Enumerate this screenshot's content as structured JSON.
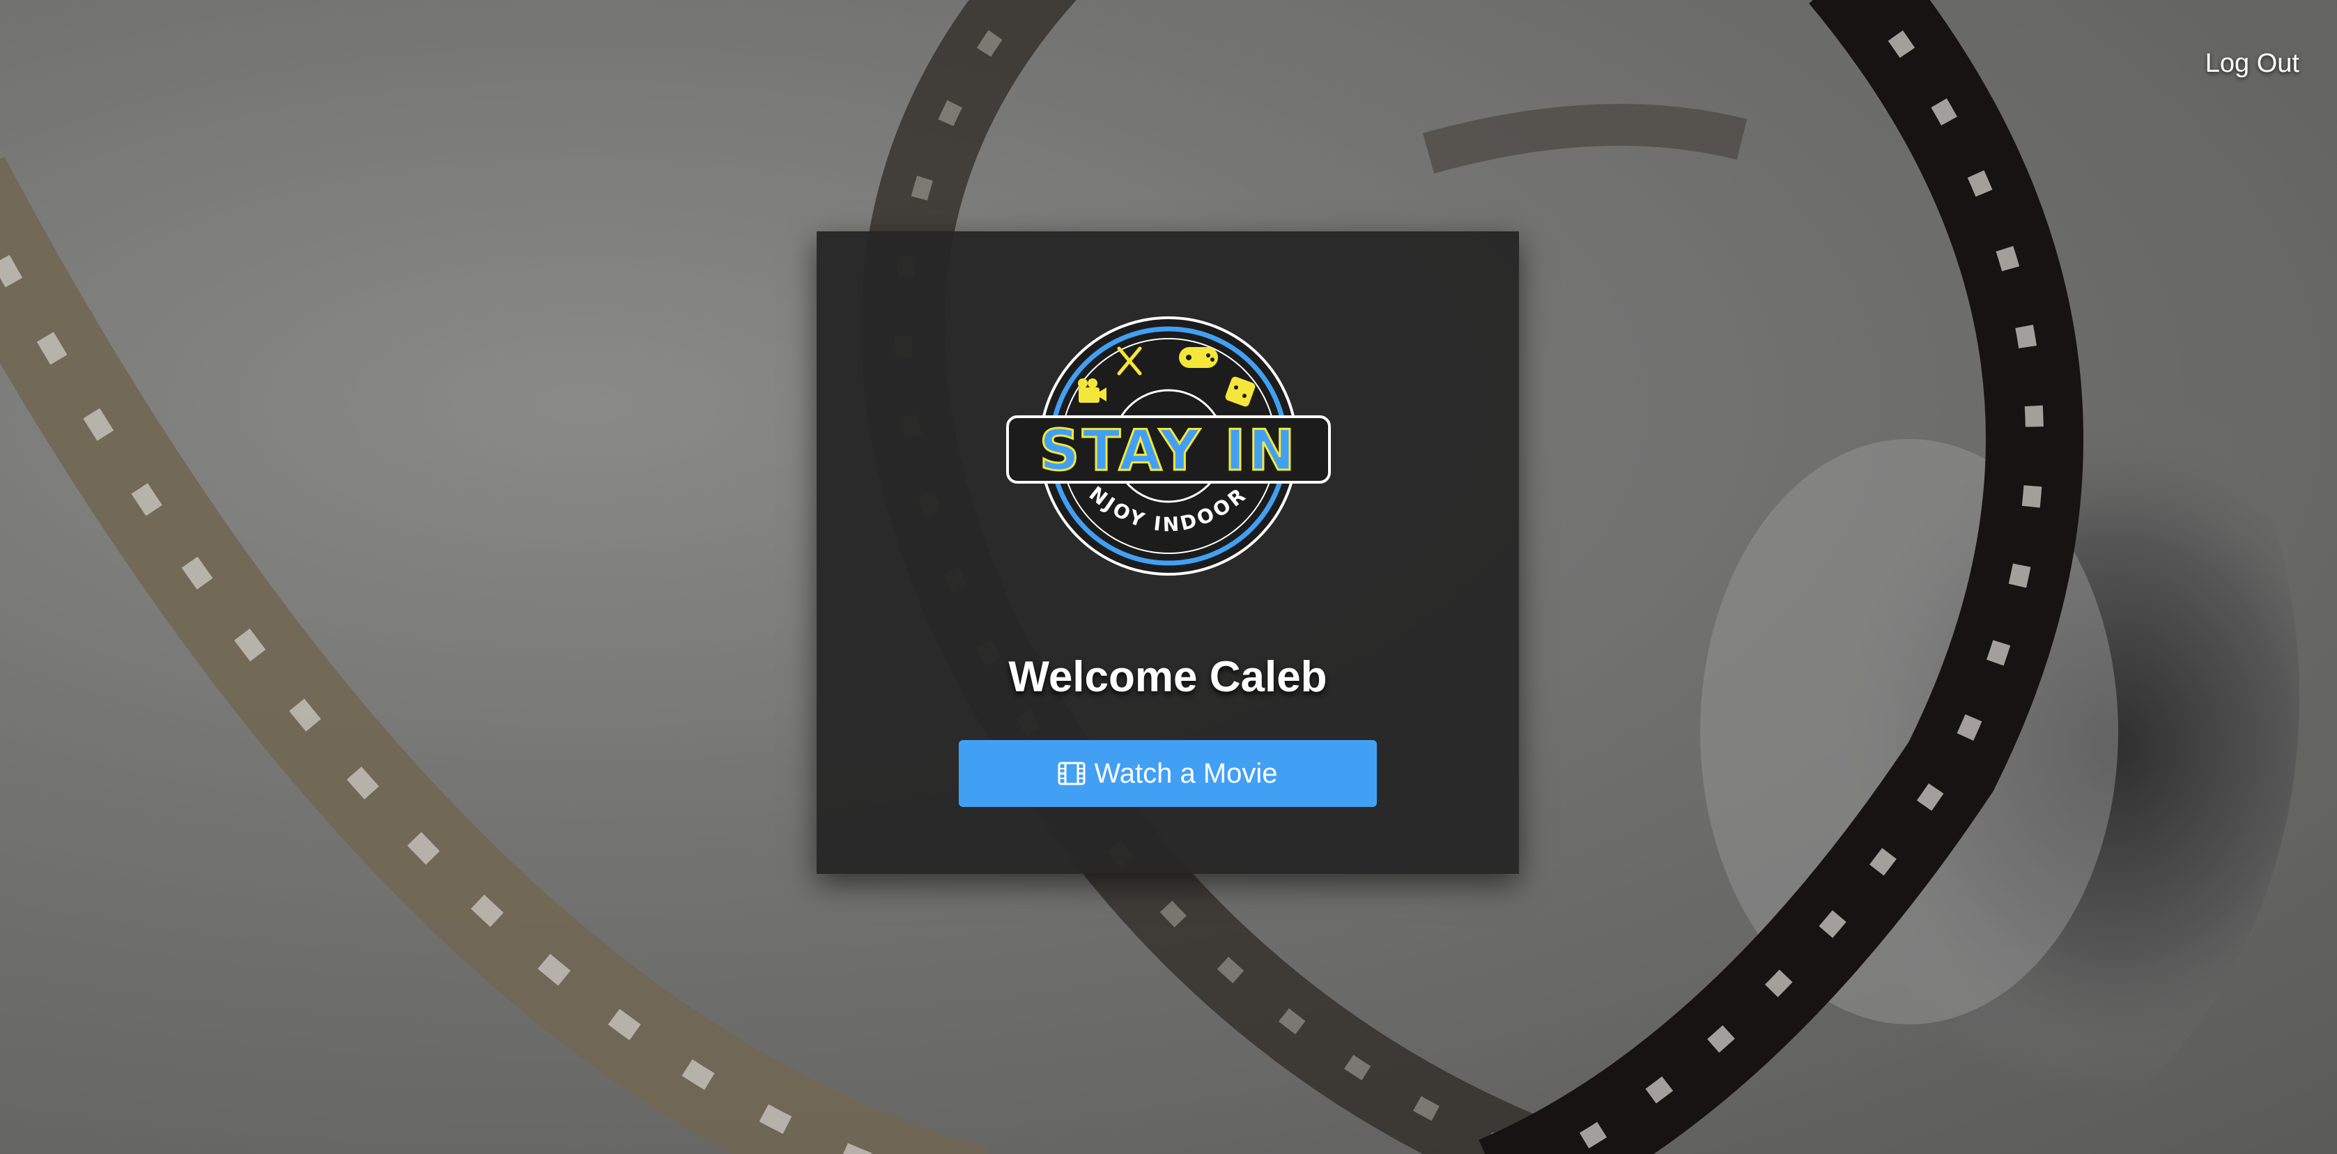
{
  "header": {
    "logout_label": "Log Out"
  },
  "logo": {
    "title": "STAY IN",
    "subtitle": "ENJOY INDOORS",
    "icons": [
      "camera-icon",
      "utensils-icon",
      "gamepad-icon",
      "dice-icon"
    ],
    "colors": {
      "primary": "#42a0f4",
      "accent": "#f5e63a",
      "ring": "#ffffff"
    }
  },
  "welcome": {
    "text": "Welcome Caleb"
  },
  "action": {
    "watch_label": "Watch a Movie",
    "icon": "film-icon",
    "color": "#42a0f4"
  }
}
